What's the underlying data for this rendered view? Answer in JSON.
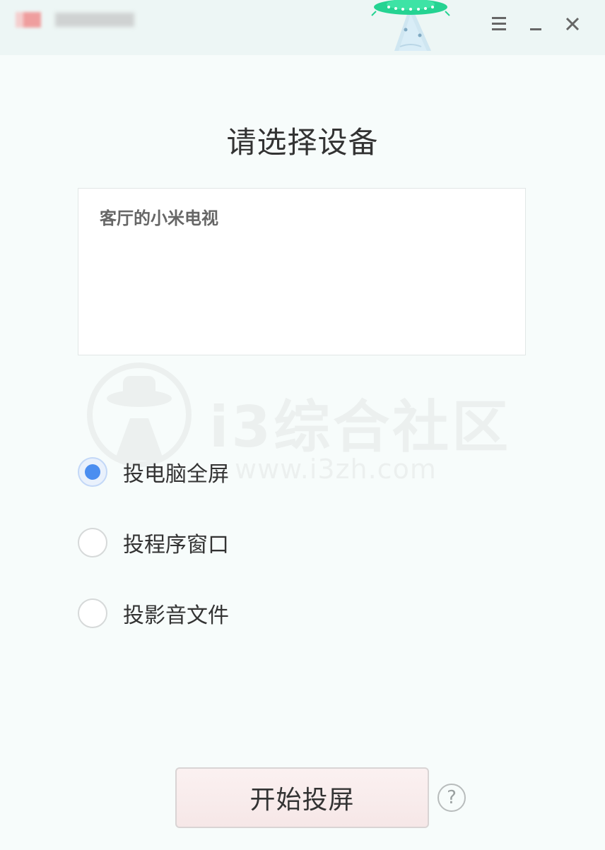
{
  "window": {
    "app_title": "········",
    "controls": {
      "menu_icon": "menu-icon",
      "minimize_icon": "minimize-icon",
      "close_icon": "close-icon"
    }
  },
  "heading": "请选择设备",
  "devices": [
    {
      "name": "客厅的小米电视"
    }
  ],
  "watermark": {
    "text": "i3综合社区",
    "url": "www.i3zh.com"
  },
  "options": [
    {
      "label": "投电脑全屏",
      "selected": true
    },
    {
      "label": "投程序窗口",
      "selected": false
    },
    {
      "label": "投影音文件",
      "selected": false
    }
  ],
  "start_button": {
    "label": "开始投屏"
  },
  "help": {
    "label": "?"
  },
  "colors": {
    "accent": "#4b8ef0",
    "background": "#f7fcfb",
    "titlebar": "#edf6f5",
    "button": "#f8ecec"
  }
}
